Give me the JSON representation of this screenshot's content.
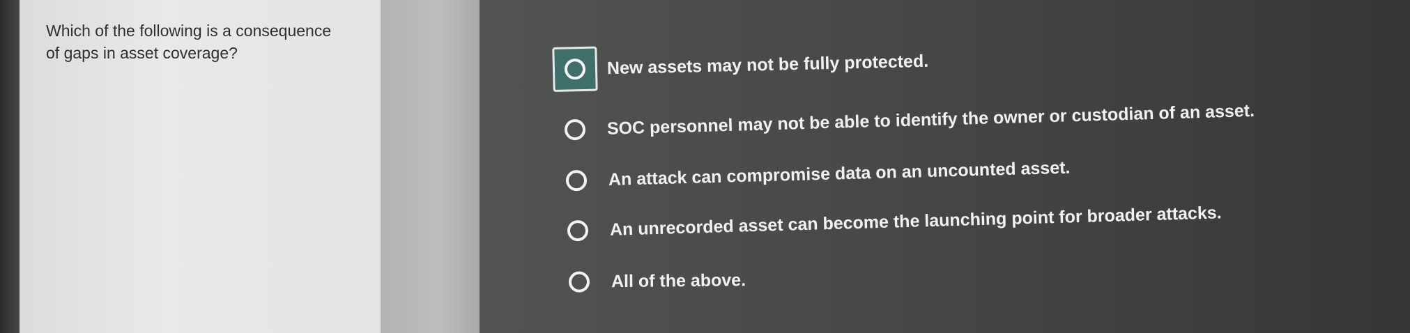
{
  "question": {
    "line1": "Which of the following is a consequence",
    "line2": "of gaps in asset coverage?"
  },
  "options": [
    {
      "label": "New assets may not be fully protected.",
      "selected": true
    },
    {
      "label": "SOC personnel may not be able to identify the owner or custodian of an asset.",
      "selected": false
    },
    {
      "label": "An attack can compromise data on an uncounted asset.",
      "selected": false
    },
    {
      "label": "An unrecorded asset can become the launching point for broader attacks.",
      "selected": false
    },
    {
      "label": "All of the above.",
      "selected": false
    }
  ],
  "colors": {
    "selected_highlight": "#3f6f68",
    "answer_background": "#4a4b4b",
    "question_background": "#e6e6e6"
  }
}
